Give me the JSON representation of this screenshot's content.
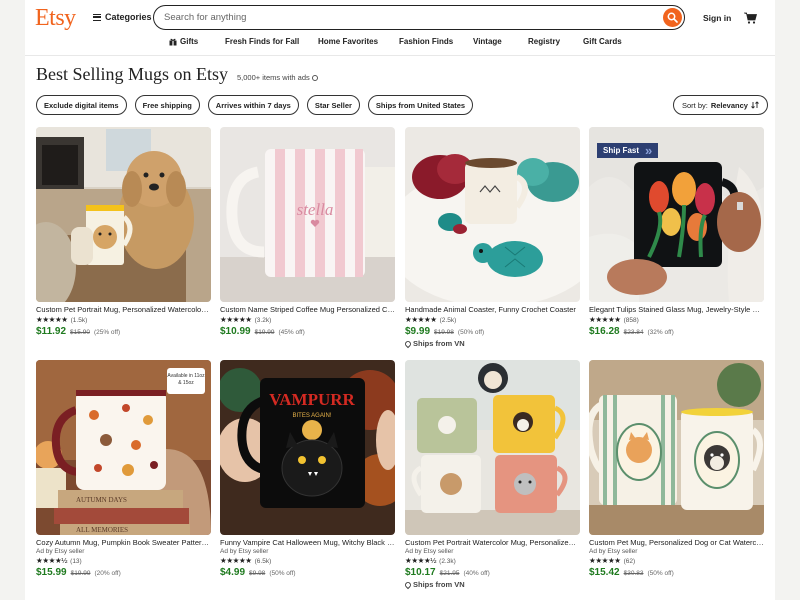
{
  "header": {
    "logo": "Etsy",
    "categories_label": "Categories",
    "search_placeholder": "Search for anything",
    "signin_label": "Sign in"
  },
  "nav": [
    "Gifts",
    "Fresh Finds for Fall",
    "Home Favorites",
    "Fashion Finds",
    "Vintage",
    "Registry",
    "Gift Cards"
  ],
  "page": {
    "title": "Best Selling Mugs on Etsy",
    "count": "5,000+ items with ads"
  },
  "filters": [
    "Exclude digital items",
    "Free shipping",
    "Arrives within 7 days",
    "Star Seller",
    "Ships from United States"
  ],
  "sort": {
    "label": "Sort by:",
    "value": "Relevancy"
  },
  "products": [
    {
      "title": "Custom Pet Portrait Mug, Personalized Watercolor Pet Mug",
      "ad": "",
      "reviews": "(1.5k)",
      "price": "$11.92",
      "orig": "$15.90",
      "disc": "(25% off)",
      "ships": ""
    },
    {
      "title": "Custom Name Striped Coffee Mug Personalized Cup",
      "ad": "",
      "reviews": "(3.2k)",
      "price": "$10.99",
      "orig": "$19.99",
      "disc": "(45% off)",
      "ships": "",
      "name_on_mug": "stella"
    },
    {
      "title": "Handmade Animal Coaster, Funny Crochet Coaster",
      "ad": "",
      "reviews": "(2.5k)",
      "price": "$9.99",
      "orig": "$19.98",
      "disc": "(50% off)",
      "ships": "Ships from VN"
    },
    {
      "title": "Elegant Tulips Stained Glass Mug, Jewelry-Style Mug",
      "ad": "",
      "reviews": "(858)",
      "price": "$16.28",
      "orig": "$23.84",
      "disc": "(32% off)",
      "ships": "",
      "ship_fast": "Ship Fast"
    },
    {
      "title": "Cozy Autumn Mug, Pumpkin Book Sweater Pattern Mug",
      "ad": "Ad by Etsy seller",
      "reviews": "(13)",
      "price": "$15.99",
      "orig": "$19.99",
      "disc": "(20% off)",
      "ships": "",
      "available_badge": "Available in 11oz & 15oz",
      "book_titles": [
        "AUTUMN DAYS",
        "ALL MEMORIES"
      ]
    },
    {
      "title": "Funny Vampire Cat Halloween Mug, Witchy Black Cat Mug",
      "ad": "Ad by Etsy seller",
      "reviews": "(6.5k)",
      "price": "$4.99",
      "orig": "$9.98",
      "disc": "(50% off)",
      "ships": "",
      "mug_text": "VAMPURR",
      "mug_subtext": "BITES AGAIN!"
    },
    {
      "title": "Custom Pet Portrait Watercolor Mug, Personalized Dog Mug",
      "ad": "Ad by Etsy seller",
      "reviews": "(2.3k)",
      "price": "$10.17",
      "orig": "$21.95",
      "disc": "(40% off)",
      "ships": "Ships from VN"
    },
    {
      "title": "Custom Pet Mug, Personalized Dog or Cat Watercolor Mug",
      "ad": "Ad by Etsy seller",
      "reviews": "(62)",
      "price": "$15.42",
      "orig": "$30.83",
      "disc": "(50% off)",
      "ships": ""
    }
  ],
  "icons": {
    "search": "search-icon",
    "cart": "cart-icon",
    "gift": "gift-icon",
    "menu": "menu-icon",
    "sort": "sort-icon",
    "location": "location-pin-icon"
  },
  "colors": {
    "brand": "#f1641e",
    "price": "#1f7a1f",
    "ship_fast": "#2d3f72"
  }
}
